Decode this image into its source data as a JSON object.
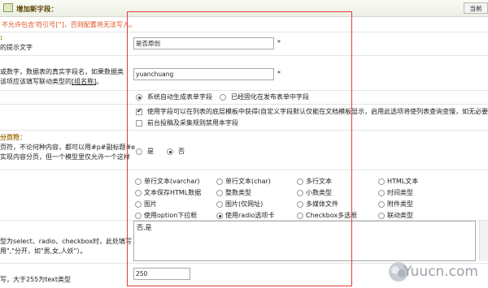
{
  "header": {
    "title": "增加新字段：",
    "return_button": "当前"
  },
  "warning": "不允许包含'符引号['']，否则配置将无法写入。",
  "field_title": {
    "label_partial": "的提示文字",
    "value": "是否原创",
    "required": "*"
  },
  "field_name": {
    "label_lines": [
      "或数字，数据表的真实字段名，如果数据类",
      "该项应该填写联动类型的"
    ],
    "label_link": "[组名称]",
    "label_after": "。",
    "value": "yuanchuang",
    "required": "*"
  },
  "form_type": {
    "options": [
      "系统自动生成表单字段",
      "已经固化在发布表单中字段"
    ],
    "selected": 0
  },
  "list_options": {
    "checkbox1": "使用字段可以在列表的底层模板中获得(自定义字段默认仅能在文档模板显示，启用此选项将使列表查询变慢，如无必要请",
    "checkbox1_checked": true,
    "checkbox2": "前台投稿及采集规则禁用本字段",
    "checkbox2_checked": false
  },
  "paging": {
    "heading": "分页符：",
    "label_lines": [
      "页符，不论何种内容，都可以用#p#副标题#e",
      "实现内容分页，但一个模型里仅允许一个这样"
    ],
    "options": [
      "是",
      "否"
    ],
    "selected": 1
  },
  "data_types": {
    "options": [
      "单行文本(varchar)",
      "单行文本(char)",
      "多行文本",
      "HTML文本",
      "文本保存HTML数据",
      "整数类型",
      "小数类型",
      "时间类型",
      "图片",
      "图片(仅网址)",
      "多媒体文件",
      "附件类型",
      "使用option下拉框",
      "使用radio选项卡",
      "Checkbox多选框",
      "联动类型"
    ],
    "selected": 13
  },
  "default_value": {
    "label_lines": [
      "型为select、radio、checkbox时，此处填写",
      "用\",\"分开，如\"男,女,人妖\"）。"
    ],
    "value": "否,是"
  },
  "max_length": {
    "label": "写，大于255为text类型",
    "value": "250"
  },
  "watermark": "Yuucn.com"
}
